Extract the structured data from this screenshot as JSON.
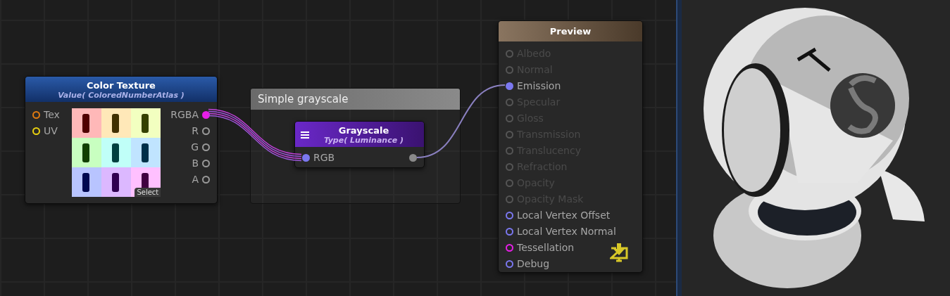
{
  "canvas": {
    "color_texture": {
      "title": "Color Texture",
      "subtitle": "Value( ColoredNumberAtlas )",
      "inputs": [
        {
          "label": "Tex",
          "connected": false,
          "color": "#e07a10"
        },
        {
          "label": "UV",
          "connected": false,
          "color": "#e8d010"
        }
      ],
      "outputs": [
        {
          "label": "RGBA",
          "connected": true,
          "color": "#e81ee8"
        },
        {
          "label": "R",
          "connected": false,
          "color": "#9a9a9a"
        },
        {
          "label": "G",
          "connected": false,
          "color": "#9a9a9a"
        },
        {
          "label": "B",
          "connected": false,
          "color": "#9a9a9a"
        },
        {
          "label": "A",
          "connected": false,
          "color": "#9a9a9a"
        }
      ],
      "thumbnail": {
        "kind": "picture",
        "select_button": "Select"
      }
    },
    "group": {
      "title": "Simple grayscale",
      "node": {
        "title": "Grayscale",
        "subtitle": "Type( Luminance )",
        "inputs": [
          {
            "label": "RGB",
            "connected": true,
            "color": "#7b78f0"
          }
        ],
        "outputs": [
          {
            "connected": true,
            "color": "#8a8a8a"
          }
        ]
      }
    },
    "preview_node": {
      "title": "Preview",
      "inputs": [
        {
          "label": "Albedo",
          "connected": false,
          "disabled": true,
          "color": "#555555"
        },
        {
          "label": "Normal",
          "connected": false,
          "disabled": true,
          "color": "#555555"
        },
        {
          "label": "Emission",
          "connected": true,
          "disabled": false,
          "color": "#7b78f0"
        },
        {
          "label": "Specular",
          "connected": false,
          "disabled": true,
          "color": "#555555"
        },
        {
          "label": "Gloss",
          "connected": false,
          "disabled": true,
          "color": "#555555"
        },
        {
          "label": "Transmission",
          "connected": false,
          "disabled": true,
          "color": "#555555"
        },
        {
          "label": "Translucency",
          "connected": false,
          "disabled": true,
          "color": "#555555"
        },
        {
          "label": "Refraction",
          "connected": false,
          "disabled": true,
          "color": "#555555"
        },
        {
          "label": "Opacity",
          "connected": false,
          "disabled": true,
          "color": "#555555"
        },
        {
          "label": "Opacity Mask",
          "connected": false,
          "disabled": true,
          "color": "#555555"
        },
        {
          "label": "Local Vertex Offset",
          "connected": false,
          "disabled": false,
          "color": "#7b78f0"
        },
        {
          "label": "Local Vertex Normal",
          "connected": false,
          "disabled": false,
          "color": "#7b78f0"
        },
        {
          "label": "Tessellation",
          "connected": false,
          "disabled": false,
          "color": "#e81ee8"
        },
        {
          "label": "Debug",
          "connected": false,
          "disabled": false,
          "color": "#7b78f0"
        }
      ]
    }
  }
}
